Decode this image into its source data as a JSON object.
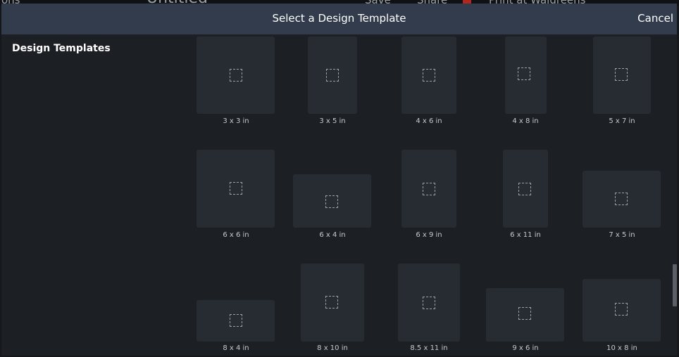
{
  "background_app": {
    "left_text": "ons",
    "center_text": "Untitled",
    "save_label": "Save",
    "share_label": "Share",
    "print_label": "Print at Walgreens"
  },
  "dialog": {
    "title": "Select a Design Template",
    "cancel_label": "Cancel"
  },
  "sidebar": {
    "heading": "Design Templates"
  },
  "templates": [
    "3 x 3 in",
    "3 x 5 in",
    "4 x 6 in",
    "4 x 8 in",
    "5 x 7 in",
    "6 x 6 in",
    "6 x 4 in",
    "6 x 9 in",
    "6 x 11 in",
    "7 x 5 in",
    "8 x 4 in",
    "8 x 10 in",
    "8.5 x 11 in",
    "9 x 6 in",
    "10 x 8 in"
  ],
  "colors": {
    "header_bg": "#333c4c",
    "modal_bg": "#1c1f24",
    "thumbnail_bg": "#272c33"
  }
}
